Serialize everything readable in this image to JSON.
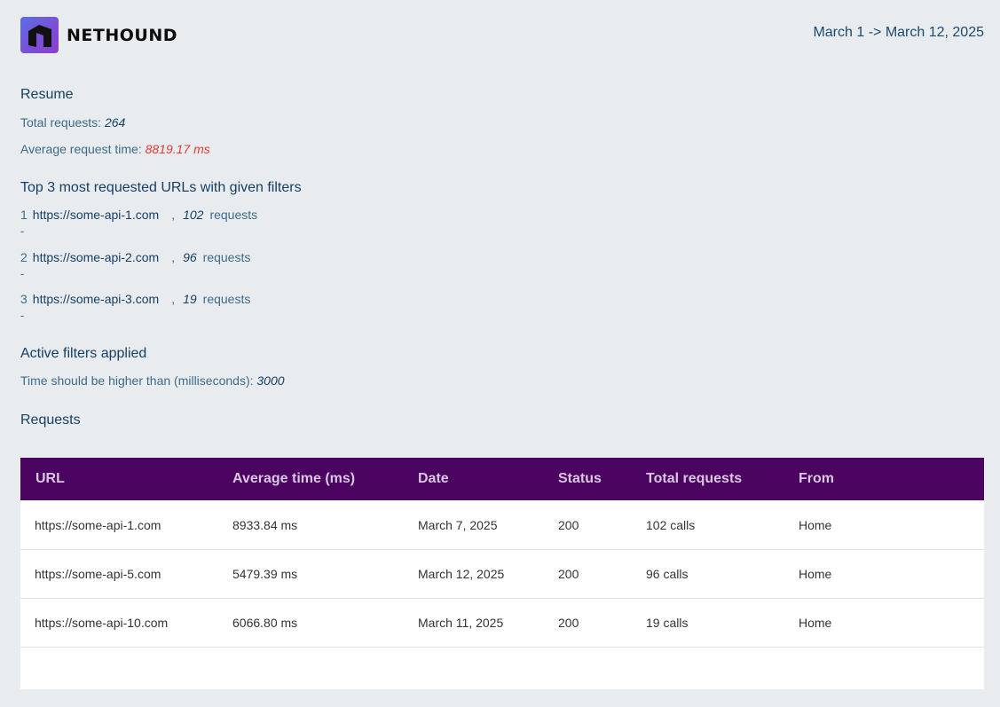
{
  "header": {
    "brand": "NETHOUND",
    "logo_icon": "nethound-logo-icon",
    "date_range": "March 1 -> March 12, 2025"
  },
  "resume": {
    "title": "Resume",
    "total_requests_label": "Total requests:",
    "total_requests_value": "264",
    "avg_time_label": "Average request time:",
    "avg_time_value": "8819.17 ms",
    "avg_time_color": "#e53935"
  },
  "top_urls": {
    "title": "Top 3 most requested URLs with given filters",
    "items": [
      {
        "rank": "1",
        "url": "https://some-api-1.com",
        "sep": ",",
        "count": "102",
        "unit": "requests",
        "dash": "-"
      },
      {
        "rank": "2",
        "url": "https://some-api-2.com",
        "sep": ",",
        "count": "96",
        "unit": "requests",
        "dash": "-"
      },
      {
        "rank": "3",
        "url": "https://some-api-3.com",
        "sep": ",",
        "count": "19",
        "unit": "requests",
        "dash": "-"
      }
    ]
  },
  "filters": {
    "title": "Active filters applied",
    "time_label": "Time should be higher than (milliseconds):",
    "time_value": "3000"
  },
  "requests": {
    "title": "Requests",
    "header_color": "#4b0460",
    "columns": [
      "URL",
      "Average time (ms)",
      "Date",
      "Status",
      "Total requests",
      "From"
    ],
    "rows": [
      [
        "https://some-api-1.com",
        "8933.84 ms",
        "March 7, 2025",
        "200",
        "102 calls",
        "Home"
      ],
      [
        "https://some-api-5.com",
        "5479.39 ms",
        "March 12, 2025",
        "200",
        "96 calls",
        "Home"
      ],
      [
        "https://some-api-10.com",
        "6066.80 ms",
        "March 11, 2025",
        "200",
        "19 calls",
        "Home"
      ]
    ]
  }
}
